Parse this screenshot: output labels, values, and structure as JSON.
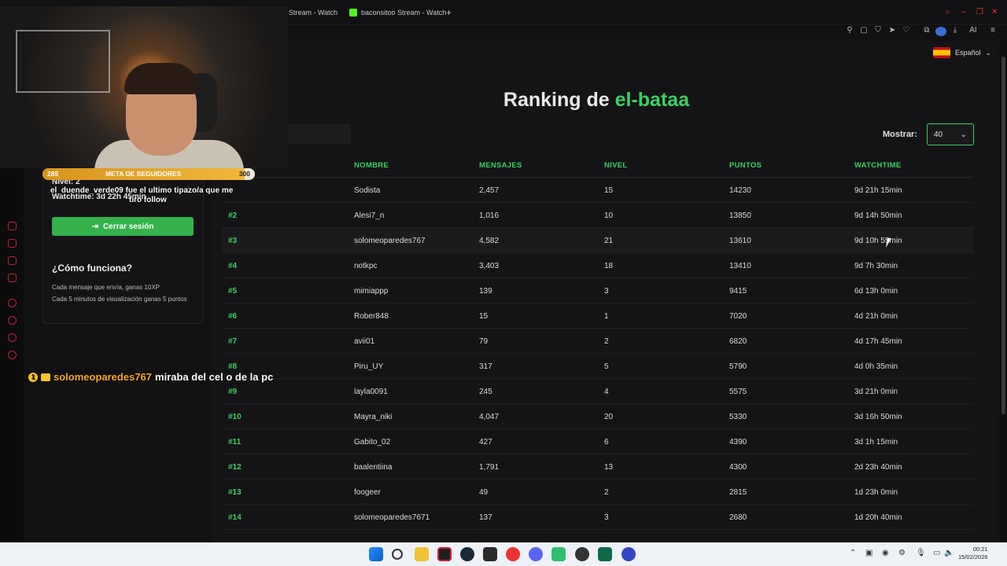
{
  "browser": {
    "tabs": [
      {
        "label": "Stream - Watch"
      },
      {
        "label": "baconsitoo Stream - Watch"
      }
    ],
    "new_tab": "+",
    "ai_label": "AI"
  },
  "language": {
    "label": "Español"
  },
  "page": {
    "title_prefix": "Ranking de",
    "title_channel": "el-bataa",
    "show_label": "Mostrar:",
    "show_value": "40"
  },
  "sidebar": {
    "level_label": "Nivel: 2",
    "watchtime_label": "Watchtime: 3d 22h 45min",
    "logout_label": "Cerrar sesión",
    "how_title": "¿Cómo funciona?",
    "how_lines": [
      "Cada mensaje que envía, ganas 10XP",
      "Cada 5 minutos de visualización ganas 5 puntos"
    ]
  },
  "table": {
    "headers": [
      "NOMBRE",
      "MENSAJES",
      "NIVEL",
      "PUNTOS",
      "WATCHTIME"
    ],
    "rows": [
      {
        "rank": "",
        "name": "Sodista",
        "messages": "2,457",
        "level": "15",
        "points": "14230",
        "watchtime": "9d 21h 15min"
      },
      {
        "rank": "#2",
        "name": "Alesi7_n",
        "messages": "1,016",
        "level": "10",
        "points": "13850",
        "watchtime": "9d 14h 50min"
      },
      {
        "rank": "#3",
        "name": "solomeoparedes767",
        "messages": "4,582",
        "level": "21",
        "points": "13610",
        "watchtime": "9d 10h 55min"
      },
      {
        "rank": "#4",
        "name": "notkpc",
        "messages": "3,403",
        "level": "18",
        "points": "13410",
        "watchtime": "9d 7h 30min"
      },
      {
        "rank": "#5",
        "name": "mimiappp",
        "messages": "139",
        "level": "3",
        "points": "9415",
        "watchtime": "6d 13h 0min"
      },
      {
        "rank": "#6",
        "name": "Rober848",
        "messages": "15",
        "level": "1",
        "points": "7020",
        "watchtime": "4d 21h 0min"
      },
      {
        "rank": "#7",
        "name": "avii01",
        "messages": "79",
        "level": "2",
        "points": "6820",
        "watchtime": "4d 17h 45min"
      },
      {
        "rank": "#8",
        "name": "Piru_UY",
        "messages": "317",
        "level": "5",
        "points": "5790",
        "watchtime": "4d 0h 35min"
      },
      {
        "rank": "#9",
        "name": "layla0091",
        "messages": "245",
        "level": "4",
        "points": "5575",
        "watchtime": "3d 21h 0min"
      },
      {
        "rank": "#10",
        "name": "Mayra_niki",
        "messages": "4,047",
        "level": "20",
        "points": "5330",
        "watchtime": "3d 16h 50min"
      },
      {
        "rank": "#11",
        "name": "Gabito_02",
        "messages": "427",
        "level": "6",
        "points": "4390",
        "watchtime": "3d 1h 15min"
      },
      {
        "rank": "#12",
        "name": "baalentiina",
        "messages": "1,791",
        "level": "13",
        "points": "4300",
        "watchtime": "2d 23h 40min"
      },
      {
        "rank": "#13",
        "name": "foogeer",
        "messages": "49",
        "level": "2",
        "points": "2815",
        "watchtime": "1d 23h 0min"
      },
      {
        "rank": "#14",
        "name": "solomeoparedes7671",
        "messages": "137",
        "level": "3",
        "points": "2680",
        "watchtime": "1d 20h 40min"
      }
    ]
  },
  "overlay": {
    "follow_goal": {
      "title": "META DE SEGUIDORES",
      "current": "285",
      "target": "300",
      "progress": 0.95
    },
    "alert_line1": "el_duende_verde09 fue el ultimo tipazo/a que me",
    "alert_line2": "tiro follow",
    "chat": {
      "user": "solomeoparedes767",
      "message": "miraba del cel o de la pc",
      "badge": "1"
    }
  },
  "taskbar": {
    "time": "00:21",
    "date": "15/02/2026"
  },
  "colors": {
    "accent": "#3ecf63",
    "logout": "#34b24b",
    "goal": "#f0b63a"
  }
}
